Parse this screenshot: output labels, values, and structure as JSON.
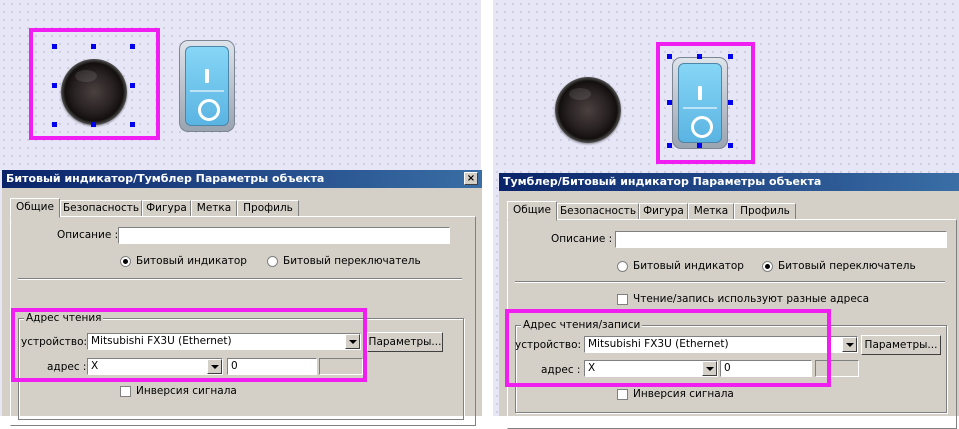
{
  "left": {
    "dialog": {
      "title": "Битовый индикатор/Тумблер Параметры объекта",
      "close": "×",
      "tabs": [
        "Общие",
        "Безопасность",
        "Фигура",
        "Метка",
        "Профиль"
      ],
      "description_label": "Описание :",
      "description_value": "",
      "radio_indicator": "Битовый индикатор",
      "radio_switch": "Битовый переключатель",
      "selected_mode": "indicator",
      "group_title": "Адрес чтения",
      "device_label": "устройство:",
      "device_value": "Mitsubishi FX3U (Ethernet)",
      "params_button": "Параметры...",
      "address_label": "адрес :",
      "address_type": "X",
      "address_value": "0",
      "invert_label": "Инверсия сигнала",
      "invert_checked": false
    }
  },
  "right": {
    "dialog": {
      "title": "Тумблер/Битовый индикатор Параметры объекта",
      "tabs": [
        "Общие",
        "Безопасность",
        "Фигура",
        "Метка",
        "Профиль"
      ],
      "description_label": "Описание :",
      "description_value": "",
      "radio_indicator": "Битовый индикатор",
      "radio_switch": "Битовый переключатель",
      "selected_mode": "switch",
      "separate_addr_label": "Чтение/запись используют разные адреса",
      "separate_addr_checked": false,
      "group_title": "Адрес чтения/записи",
      "device_label": "устройство:",
      "device_value": "Mitsubishi FX3U (Ethernet)",
      "params_button": "Параметры...",
      "address_label": "адрес :",
      "address_type": "X",
      "address_value": "0",
      "invert_label": "Инверсия сигнала",
      "invert_checked": false
    }
  },
  "colors": {
    "highlight": "#f01ef0",
    "handle": "#0000ee",
    "titlebar_start": "#0a246a",
    "titlebar_end": "#3a6ea5",
    "dialog_bg": "#d4d0c8",
    "canvas_bg": "#e6e6f6"
  },
  "icons": {
    "indicator": "round-lamp-icon",
    "switch": "rocker-switch-icon"
  }
}
